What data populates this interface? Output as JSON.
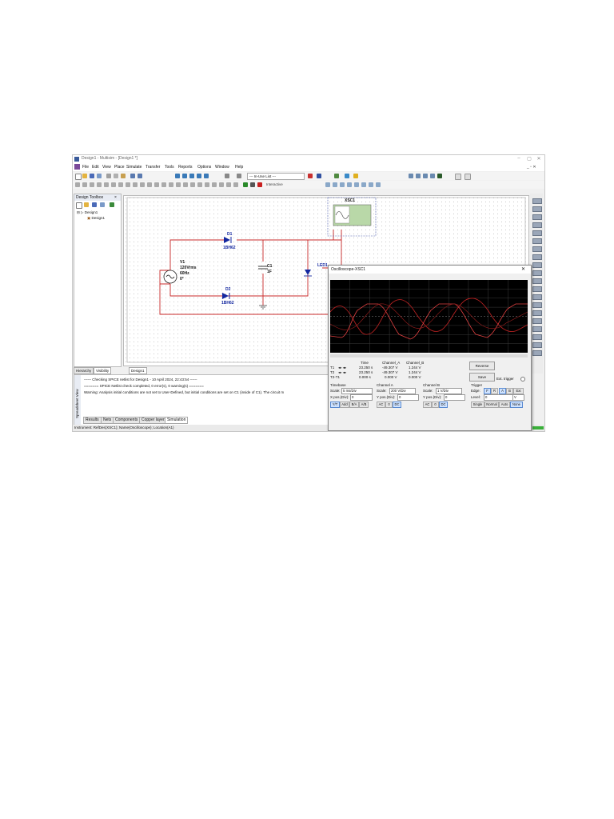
{
  "window": {
    "title": "Design1 - Multisim - [Design1 *]",
    "controls": [
      "–",
      "▢",
      "✕"
    ]
  },
  "menu": {
    "items": [
      "File",
      "Edit",
      "View",
      "Place",
      "Simulate",
      "Transfer",
      "Tools",
      "Reports",
      "Options",
      "Window",
      "Help"
    ]
  },
  "toolbar": {
    "in_use_list": "--- In-Use List ---",
    "interactive": "Interactive"
  },
  "toolbox": {
    "title": "Design Toolbox",
    "tree_root": "Design1",
    "tree_child": "Design1"
  },
  "canvas": {
    "tabs": [
      "Hierarchy",
      "Visibility"
    ],
    "design_tab": "Design1"
  },
  "components": {
    "d1_name": "D1",
    "d1_model": "1BH62",
    "d2_name": "D2",
    "d2_model": "1BH62",
    "v1_name": "V1",
    "v1_vrms": "120Vrms",
    "v1_freq": "60Hz",
    "v1_phase": "0°",
    "c1_name": "C1",
    "c1_value": "1F",
    "led_name": "LED1",
    "scope_name": "XSC1"
  },
  "spreadsheet": {
    "side_label": "Spreadsheet View",
    "log": [
      "------ Checking SPICE netlist for Design1 - 10 April 2024, 22:43:54 ------",
      "======= SPICE Netlist check completed, 0 error(s), 0 warning(s) =======",
      "Warning: Analysis initial conditions are not set to User-Defined, but initial conditions are set on C1 (inside of C1). The circuit m"
    ],
    "tabs": [
      "Results",
      "Nets",
      "Components",
      "Copper layers",
      "Simulation"
    ]
  },
  "status": {
    "text": "Instrument: RefDes(XSC1); Name(Oscilloscope); Location(A1)"
  },
  "oscilloscope": {
    "title": "Oscilloscope-XSC1",
    "readout_headers": [
      "Time",
      "Channel_A",
      "Channel_B"
    ],
    "readout_rows": [
      {
        "label": "T1",
        "time": "23.250 s",
        "a": "-49.307 V",
        "b": "1.244 V"
      },
      {
        "label": "T2",
        "time": "23.250 s",
        "a": "-49.307 V",
        "b": "1.244 V"
      },
      {
        "label": "T2-T1",
        "time": "0.000 s",
        "a": "0.000 V",
        "b": "0.000 V"
      }
    ],
    "reverse": "Reverse",
    "save": "Save",
    "ext_trigger": "Ext. trigger",
    "timebase": {
      "title": "Timebase",
      "scale_label": "Scale:",
      "scale": "5 ms/Div",
      "pos_label": "X pos.(Div):",
      "pos": "0",
      "modes": [
        "Y/T",
        "Add",
        "B/A",
        "A/B"
      ]
    },
    "channel_a": {
      "title": "Channel A",
      "scale_label": "Scale:",
      "scale": "200 V/Div",
      "pos_label": "Y pos.(Div):",
      "pos": "0",
      "coupling": [
        "AC",
        "0",
        "DC"
      ]
    },
    "channel_b": {
      "title": "Channel B",
      "scale_label": "Scale:",
      "scale": "1 V/Div",
      "pos_label": "Y pos.(Div):",
      "pos": "0",
      "coupling": [
        "AC",
        "0",
        "DC"
      ]
    },
    "trigger": {
      "title": "Trigger",
      "edge_label": "Edge:",
      "edge_options": [
        "F",
        "R",
        "A",
        "B",
        "Ext"
      ],
      "level_label": "Level:",
      "level": "0",
      "level_unit": "V",
      "modes": [
        "Single",
        "Normal",
        "Auto",
        "None"
      ]
    }
  }
}
